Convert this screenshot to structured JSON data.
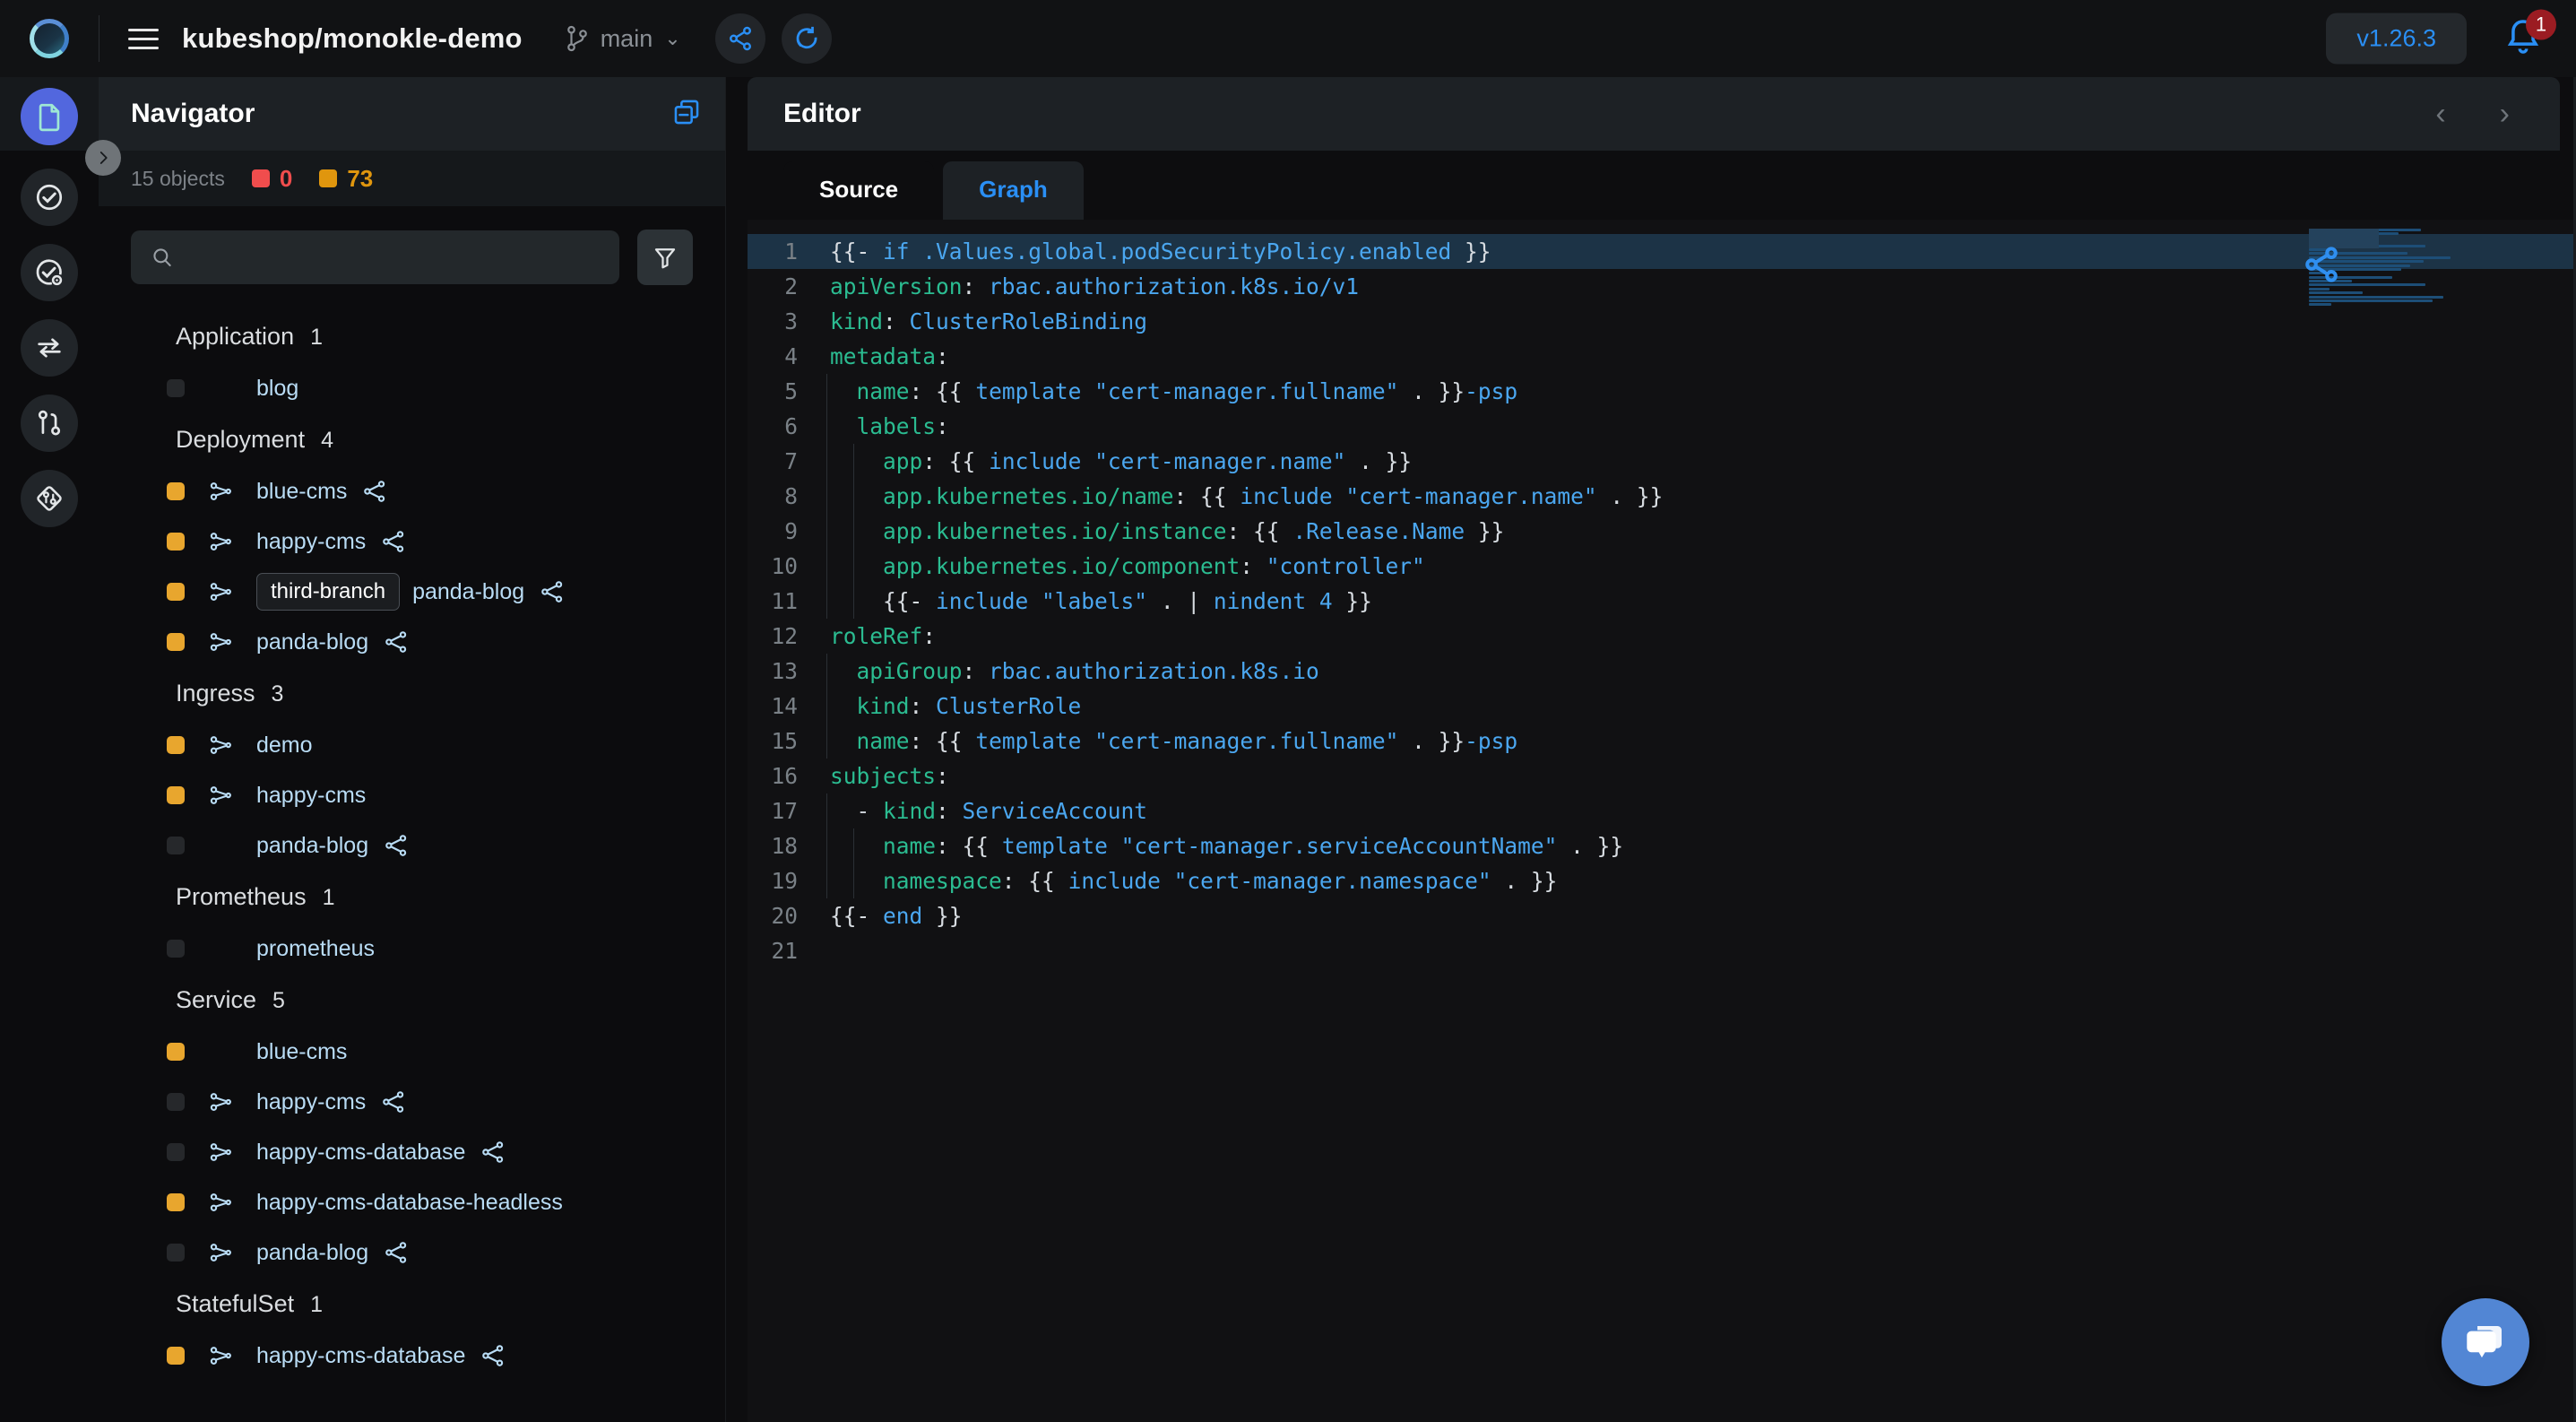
{
  "topbar": {
    "logo_icon": "monokle-logo-icon",
    "menu_icon": "hamburger-menu-icon",
    "repo_title": "kubeshop/monokle-demo",
    "branch_icon": "git-branch-icon",
    "branch_name": "main",
    "branch_chevron_icon": "chevron-down-icon",
    "share_icon": "share-nodes-icon",
    "refresh_icon": "refresh-icon",
    "version_label": "v1.26.3",
    "bell_icon": "bell-icon",
    "notification_count": "1"
  },
  "activitybar": {
    "items": [
      {
        "name": "file-explorer-icon",
        "active": true
      },
      {
        "name": "validation-check-icon",
        "active": false
      },
      {
        "name": "validation-settings-icon",
        "active": false
      },
      {
        "name": "compare-sync-icon",
        "active": false
      },
      {
        "name": "git-graph-icon",
        "active": false
      },
      {
        "name": "helm-icon",
        "active": false
      }
    ],
    "collapse_icon": "chevron-right-icon"
  },
  "navigator": {
    "title": "Navigator",
    "collapse_all_icon": "collapse-all-icon",
    "object_count": "15 objects",
    "errors": {
      "value": "0",
      "color": "#f04d4d"
    },
    "warnings": {
      "value": "73",
      "color": "#e8a62e"
    },
    "search": {
      "icon": "search-icon",
      "value": "",
      "placeholder": ""
    },
    "filter_icon": "filter-funnel-icon",
    "groups": [
      {
        "label": "Application",
        "count": "1",
        "items": [
          {
            "name": "blog",
            "status": "none",
            "kind_icon": false,
            "share_icon": false,
            "tag": ""
          }
        ]
      },
      {
        "label": "Deployment",
        "count": "4",
        "items": [
          {
            "name": "blue-cms",
            "status": "warn",
            "kind_icon": true,
            "share_icon": true,
            "tag": ""
          },
          {
            "name": "happy-cms",
            "status": "warn",
            "kind_icon": true,
            "share_icon": true,
            "tag": ""
          },
          {
            "name": "panda-blog",
            "status": "warn",
            "kind_icon": true,
            "share_icon": true,
            "tag": "third-branch"
          },
          {
            "name": "panda-blog",
            "status": "warn",
            "kind_icon": true,
            "share_icon": true,
            "tag": ""
          }
        ]
      },
      {
        "label": "Ingress",
        "count": "3",
        "items": [
          {
            "name": "demo",
            "status": "warn",
            "kind_icon": true,
            "share_icon": false,
            "tag": ""
          },
          {
            "name": "happy-cms",
            "status": "warn",
            "kind_icon": true,
            "share_icon": false,
            "tag": ""
          },
          {
            "name": "panda-blog",
            "status": "none",
            "kind_icon": false,
            "share_icon": true,
            "tag": ""
          }
        ]
      },
      {
        "label": "Prometheus",
        "count": "1",
        "items": [
          {
            "name": "prometheus",
            "status": "none",
            "kind_icon": false,
            "share_icon": false,
            "tag": ""
          }
        ]
      },
      {
        "label": "Service",
        "count": "5",
        "items": [
          {
            "name": "blue-cms",
            "status": "warn",
            "kind_icon": false,
            "share_icon": false,
            "tag": ""
          },
          {
            "name": "happy-cms",
            "status": "none",
            "kind_icon": true,
            "share_icon": true,
            "tag": ""
          },
          {
            "name": "happy-cms-database",
            "status": "none",
            "kind_icon": true,
            "share_icon": true,
            "tag": ""
          },
          {
            "name": "happy-cms-database-headless",
            "status": "warn",
            "kind_icon": true,
            "share_icon": false,
            "tag": ""
          },
          {
            "name": "panda-blog",
            "status": "none",
            "kind_icon": true,
            "share_icon": true,
            "tag": ""
          }
        ]
      },
      {
        "label": "StatefulSet",
        "count": "1",
        "items": [
          {
            "name": "happy-cms-database",
            "status": "warn",
            "kind_icon": true,
            "share_icon": true,
            "tag": ""
          }
        ]
      }
    ]
  },
  "editor": {
    "title": "Editor",
    "prev_icon": "chevron-left-icon",
    "next_icon": "chevron-right-icon",
    "tabs": [
      {
        "label": "Source",
        "active": true
      },
      {
        "label": "Graph",
        "active": false
      }
    ],
    "minimap_share_icon": "share-nodes-icon",
    "lines": [
      {
        "n": "1",
        "highlight": true,
        "indent": 0,
        "tokens": [
          {
            "t": "pun",
            "v": "{{- "
          },
          {
            "t": "val",
            "v": "if "
          },
          {
            "t": "val",
            "v": ".Values.global.podSecurityPolicy.enabled"
          },
          {
            "t": "pun",
            "v": " }}"
          }
        ]
      },
      {
        "n": "2",
        "highlight": false,
        "indent": 0,
        "tokens": [
          {
            "t": "key",
            "v": "apiVersion"
          },
          {
            "t": "pun",
            "v": ": "
          },
          {
            "t": "val",
            "v": "rbac.authorization.k8s.io/v1"
          }
        ]
      },
      {
        "n": "3",
        "highlight": false,
        "indent": 0,
        "tokens": [
          {
            "t": "key",
            "v": "kind"
          },
          {
            "t": "pun",
            "v": ": "
          },
          {
            "t": "val",
            "v": "ClusterRoleBinding"
          }
        ]
      },
      {
        "n": "4",
        "highlight": false,
        "indent": 0,
        "tokens": [
          {
            "t": "key",
            "v": "metadata"
          },
          {
            "t": "pun",
            "v": ":"
          }
        ]
      },
      {
        "n": "5",
        "highlight": false,
        "indent": 1,
        "tokens": [
          {
            "t": "plain",
            "v": "  "
          },
          {
            "t": "key",
            "v": "name"
          },
          {
            "t": "pun",
            "v": ": "
          },
          {
            "t": "pun",
            "v": "{{ "
          },
          {
            "t": "val",
            "v": "template "
          },
          {
            "t": "val",
            "v": "\"cert-manager.fullname\""
          },
          {
            "t": "pun",
            "v": " . }}"
          },
          {
            "t": "val",
            "v": "-psp"
          }
        ]
      },
      {
        "n": "6",
        "highlight": false,
        "indent": 1,
        "tokens": [
          {
            "t": "plain",
            "v": "  "
          },
          {
            "t": "key",
            "v": "labels"
          },
          {
            "t": "pun",
            "v": ":"
          }
        ]
      },
      {
        "n": "7",
        "highlight": false,
        "indent": 2,
        "tokens": [
          {
            "t": "plain",
            "v": "    "
          },
          {
            "t": "key",
            "v": "app"
          },
          {
            "t": "pun",
            "v": ": "
          },
          {
            "t": "pun",
            "v": "{{ "
          },
          {
            "t": "val",
            "v": "include "
          },
          {
            "t": "val",
            "v": "\"cert-manager.name\""
          },
          {
            "t": "pun",
            "v": " . }}"
          }
        ]
      },
      {
        "n": "8",
        "highlight": false,
        "indent": 2,
        "tokens": [
          {
            "t": "plain",
            "v": "    "
          },
          {
            "t": "key",
            "v": "app.kubernetes.io/name"
          },
          {
            "t": "pun",
            "v": ": "
          },
          {
            "t": "pun",
            "v": "{{ "
          },
          {
            "t": "val",
            "v": "include "
          },
          {
            "t": "val",
            "v": "\"cert-manager.name\""
          },
          {
            "t": "pun",
            "v": " . }}"
          }
        ]
      },
      {
        "n": "9",
        "highlight": false,
        "indent": 2,
        "tokens": [
          {
            "t": "plain",
            "v": "    "
          },
          {
            "t": "key",
            "v": "app.kubernetes.io/instance"
          },
          {
            "t": "pun",
            "v": ": "
          },
          {
            "t": "pun",
            "v": "{{ "
          },
          {
            "t": "val",
            "v": ".Release.Name"
          },
          {
            "t": "pun",
            "v": " }}"
          }
        ]
      },
      {
        "n": "10",
        "highlight": false,
        "indent": 2,
        "tokens": [
          {
            "t": "plain",
            "v": "    "
          },
          {
            "t": "key",
            "v": "app.kubernetes.io/component"
          },
          {
            "t": "pun",
            "v": ": "
          },
          {
            "t": "val",
            "v": "\"controller\""
          }
        ]
      },
      {
        "n": "11",
        "highlight": false,
        "indent": 2,
        "tokens": [
          {
            "t": "plain",
            "v": "    "
          },
          {
            "t": "pun",
            "v": "{{- "
          },
          {
            "t": "val",
            "v": "include "
          },
          {
            "t": "val",
            "v": "\"labels\""
          },
          {
            "t": "pun",
            "v": " . | "
          },
          {
            "t": "val",
            "v": "nindent "
          },
          {
            "t": "val",
            "v": "4"
          },
          {
            "t": "pun",
            "v": " }}"
          }
        ]
      },
      {
        "n": "12",
        "highlight": false,
        "indent": 0,
        "tokens": [
          {
            "t": "key",
            "v": "roleRef"
          },
          {
            "t": "pun",
            "v": ":"
          }
        ]
      },
      {
        "n": "13",
        "highlight": false,
        "indent": 1,
        "tokens": [
          {
            "t": "plain",
            "v": "  "
          },
          {
            "t": "key",
            "v": "apiGroup"
          },
          {
            "t": "pun",
            "v": ": "
          },
          {
            "t": "val",
            "v": "rbac.authorization.k8s.io"
          }
        ]
      },
      {
        "n": "14",
        "highlight": false,
        "indent": 1,
        "tokens": [
          {
            "t": "plain",
            "v": "  "
          },
          {
            "t": "key",
            "v": "kind"
          },
          {
            "t": "pun",
            "v": ": "
          },
          {
            "t": "val",
            "v": "ClusterRole"
          }
        ]
      },
      {
        "n": "15",
        "highlight": false,
        "indent": 1,
        "tokens": [
          {
            "t": "plain",
            "v": "  "
          },
          {
            "t": "key",
            "v": "name"
          },
          {
            "t": "pun",
            "v": ": "
          },
          {
            "t": "pun",
            "v": "{{ "
          },
          {
            "t": "val",
            "v": "template "
          },
          {
            "t": "val",
            "v": "\"cert-manager.fullname\""
          },
          {
            "t": "pun",
            "v": " . }}"
          },
          {
            "t": "val",
            "v": "-psp"
          }
        ]
      },
      {
        "n": "16",
        "highlight": false,
        "indent": 0,
        "tokens": [
          {
            "t": "key",
            "v": "subjects"
          },
          {
            "t": "pun",
            "v": ":"
          }
        ]
      },
      {
        "n": "17",
        "highlight": false,
        "indent": 1,
        "tokens": [
          {
            "t": "plain",
            "v": "  - "
          },
          {
            "t": "key",
            "v": "kind"
          },
          {
            "t": "pun",
            "v": ": "
          },
          {
            "t": "val",
            "v": "ServiceAccount"
          }
        ]
      },
      {
        "n": "18",
        "highlight": false,
        "indent": 2,
        "tokens": [
          {
            "t": "plain",
            "v": "    "
          },
          {
            "t": "key",
            "v": "name"
          },
          {
            "t": "pun",
            "v": ": "
          },
          {
            "t": "pun",
            "v": "{{ "
          },
          {
            "t": "val",
            "v": "template "
          },
          {
            "t": "val",
            "v": "\"cert-manager.serviceAccountName\""
          },
          {
            "t": "pun",
            "v": " . }}"
          }
        ]
      },
      {
        "n": "19",
        "highlight": false,
        "indent": 2,
        "tokens": [
          {
            "t": "plain",
            "v": "    "
          },
          {
            "t": "key",
            "v": "namespace"
          },
          {
            "t": "pun",
            "v": ": "
          },
          {
            "t": "pun",
            "v": "{{ "
          },
          {
            "t": "val",
            "v": "include "
          },
          {
            "t": "val",
            "v": "\"cert-manager.namespace\""
          },
          {
            "t": "pun",
            "v": " . }}"
          }
        ]
      },
      {
        "n": "20",
        "highlight": false,
        "indent": 0,
        "tokens": [
          {
            "t": "pun",
            "v": "{{- "
          },
          {
            "t": "val",
            "v": "end"
          },
          {
            "t": "pun",
            "v": " }}"
          }
        ]
      },
      {
        "n": "21",
        "highlight": false,
        "indent": 0,
        "tokens": []
      }
    ]
  },
  "chat": {
    "icon": "chat-bubble-icon"
  }
}
